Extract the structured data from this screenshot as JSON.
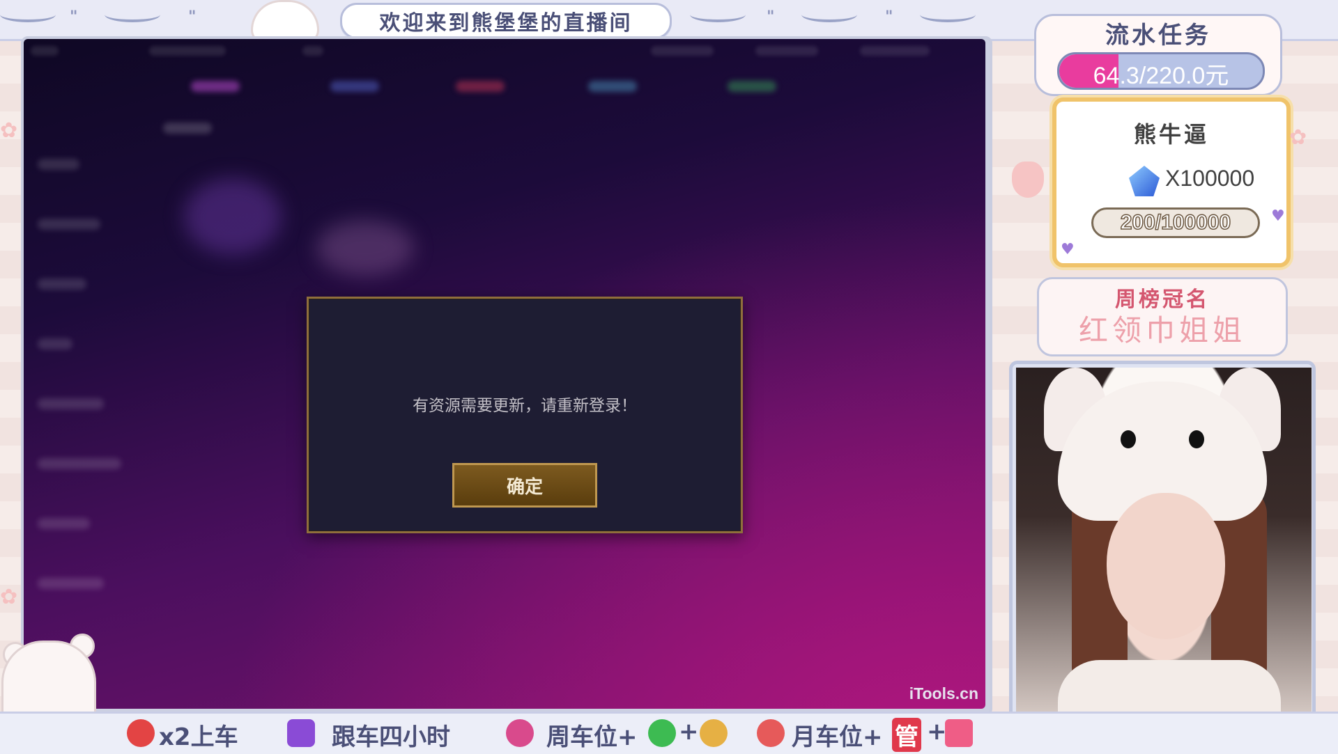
{
  "stream": {
    "title": "欢迎来到熊堡堡的直播间"
  },
  "game": {
    "dialog": {
      "message": "有资源需要更新，请重新登录！",
      "confirm_label": "确定"
    },
    "watermark": "iTools.cn"
  },
  "task": {
    "title": "流水任务",
    "progress_text": "64.3/220.0元",
    "progress_fraction": 0.292
  },
  "gift_goal": {
    "name": "熊牛逼",
    "multiplier": "X100000",
    "progress_text": "200/100000",
    "icon": "crystal-icon"
  },
  "weekly": {
    "title": "周榜冠名",
    "name": "红领巾姐姐"
  },
  "ticker": [
    {
      "icon": "potion-icon",
      "text": "x2上车"
    },
    {
      "icon": "book-icon",
      "text": "跟车四小时"
    },
    {
      "icon": "guard-shield-icon",
      "text": "周车位+"
    },
    {
      "icon": "wechat-icon",
      "text": "+"
    },
    {
      "icon": "badge-icon",
      "text": ""
    },
    {
      "icon": "rocket-icon",
      "text": "月车位+"
    },
    {
      "icon": "admin-badge-icon",
      "text": "管"
    },
    {
      "icon": "diamond-icon",
      "text": "+"
    }
  ],
  "colors": {
    "accent_pink": "#e93c9e",
    "panel_outline": "#b8bedb",
    "dialog_border": "#8f6f3c"
  }
}
